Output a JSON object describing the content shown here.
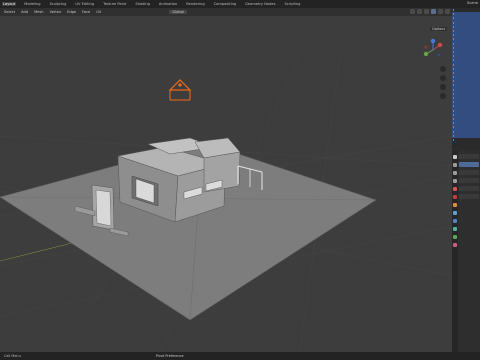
{
  "topbar": {
    "workspaces": [
      "Layout",
      "Modeling",
      "Sculpting",
      "UV Editing",
      "Texture Paint",
      "Shading",
      "Animation",
      "Rendering",
      "Compositing",
      "Geometry Nodes",
      "Scripting"
    ],
    "scene": "Scene"
  },
  "viewport": {
    "menus": [
      "Object",
      "View",
      "Select",
      "Add",
      "Object"
    ],
    "header_items": [
      "Select",
      "Add",
      "Mesh",
      "Vertex",
      "Edge",
      "Face",
      "UV"
    ],
    "pivot": "Global",
    "options_label": "Options"
  },
  "outliner": {
    "rows": [
      "",
      "",
      "",
      "",
      "",
      "",
      "",
      "",
      "",
      "",
      "",
      "",
      "",
      "",
      "",
      "",
      "",
      "",
      "",
      "",
      "",
      "",
      "",
      "",
      "",
      "",
      "",
      "",
      "",
      "",
      "",
      ""
    ]
  },
  "status": {
    "left": "Call Menu",
    "center": "Pivot Preference",
    "right": ""
  },
  "colors": {
    "selection_orange": "#f06a1a",
    "accent_blue": "#4c6b98"
  }
}
